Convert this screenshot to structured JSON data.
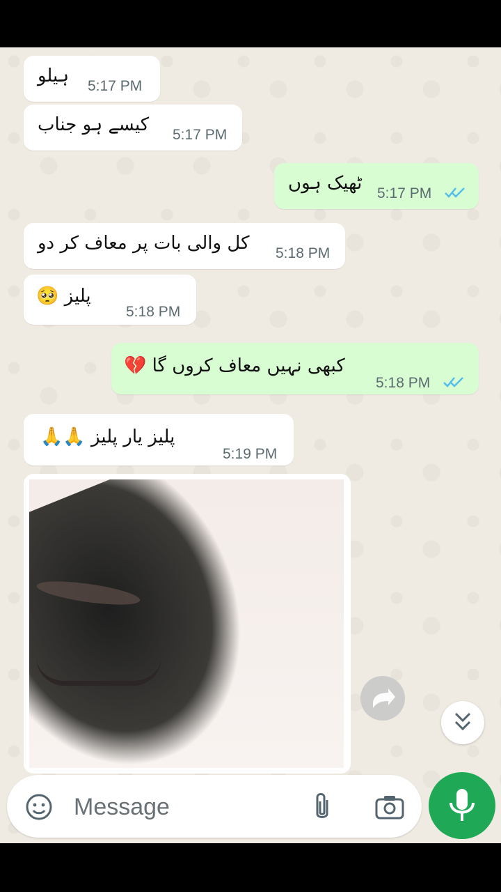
{
  "messages": [
    {
      "dir": "in",
      "text": "ہیلو",
      "time": "5:17 PM"
    },
    {
      "dir": "in",
      "text": "کیسے ہو جناب",
      "time": "5:17 PM"
    },
    {
      "dir": "out",
      "text": "ٹھیک ہوں",
      "time": "5:17 PM"
    },
    {
      "dir": "in",
      "text": "کل والی بات پر معاف کر دو",
      "time": "5:18 PM"
    },
    {
      "dir": "in",
      "text": "پلیز 🥺",
      "time": "5:18 PM"
    },
    {
      "dir": "out",
      "text": "کبھی نہیں معاف کروں گا 💔",
      "time": "5:18 PM"
    },
    {
      "dir": "in",
      "text": "پلیز یار پلیز 🙏🙏",
      "time": "5:19 PM"
    }
  ],
  "input": {
    "placeholder": "Message"
  },
  "icons": {
    "sticker": "sticker-icon",
    "attach": "paperclip-icon",
    "camera": "camera-icon",
    "mic": "mic-icon",
    "forward": "forward-icon",
    "scroll": "chevron-double-down-icon",
    "read": "double-check-icon"
  },
  "colors": {
    "incoming": "#ffffff",
    "outgoing": "#d9fdd3",
    "accent": "#1fa855",
    "read_ticks": "#53bdeb"
  }
}
